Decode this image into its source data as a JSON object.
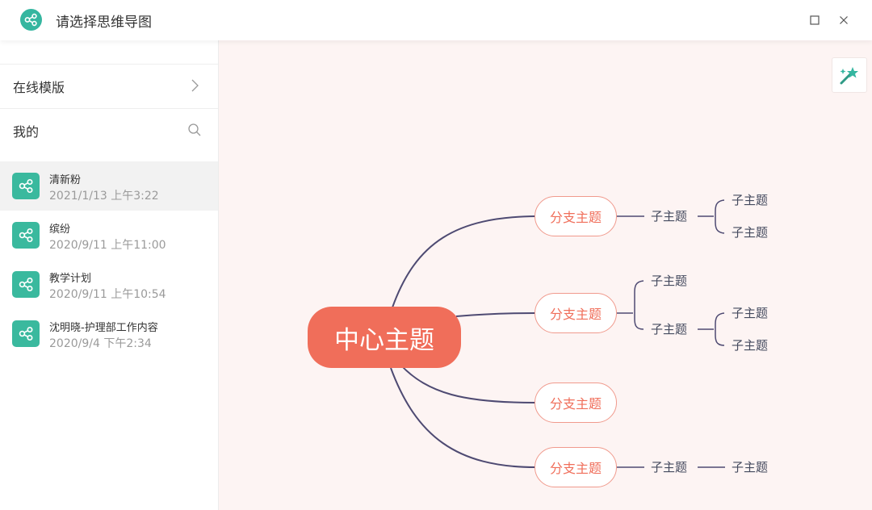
{
  "window": {
    "title": "请选择思维导图"
  },
  "sidebar": {
    "online_templates_label": "在线模版",
    "mine_label": "我的",
    "files": [
      {
        "name": "清新粉",
        "date": "2021/1/13 上午3:22"
      },
      {
        "name": "缤纷",
        "date": "2020/9/11 上午11:00"
      },
      {
        "name": "教学计划",
        "date": "2020/9/11 上午10:54"
      },
      {
        "name": "沈明晓-护理部工作内容",
        "date": "2020/9/4 下午2:34"
      }
    ]
  },
  "mindmap": {
    "central": "中心主题",
    "branches": [
      {
        "label": "分支主题",
        "subs": [
          "子主题",
          "子主题",
          "子主题"
        ]
      },
      {
        "label": "分支主题",
        "subs": [
          "子主题",
          "子主题",
          "子主题",
          "子主题"
        ]
      },
      {
        "label": "分支主题",
        "subs": []
      },
      {
        "label": "分支主题",
        "subs": [
          "子主题",
          "子主题"
        ]
      }
    ]
  },
  "colors": {
    "accent": "#35b6a0",
    "central_fill": "#f06e5a",
    "branch_border": "#f09a8d",
    "line": "#4e4a72",
    "canvas_bg": "#fdf4f3"
  },
  "icons": {
    "app_logo": "mindmap-share-icon",
    "online_chevron": "chevron-right-icon",
    "search": "search-icon",
    "file": "mindmap-share-icon",
    "magic": "magic-wand-icon"
  }
}
